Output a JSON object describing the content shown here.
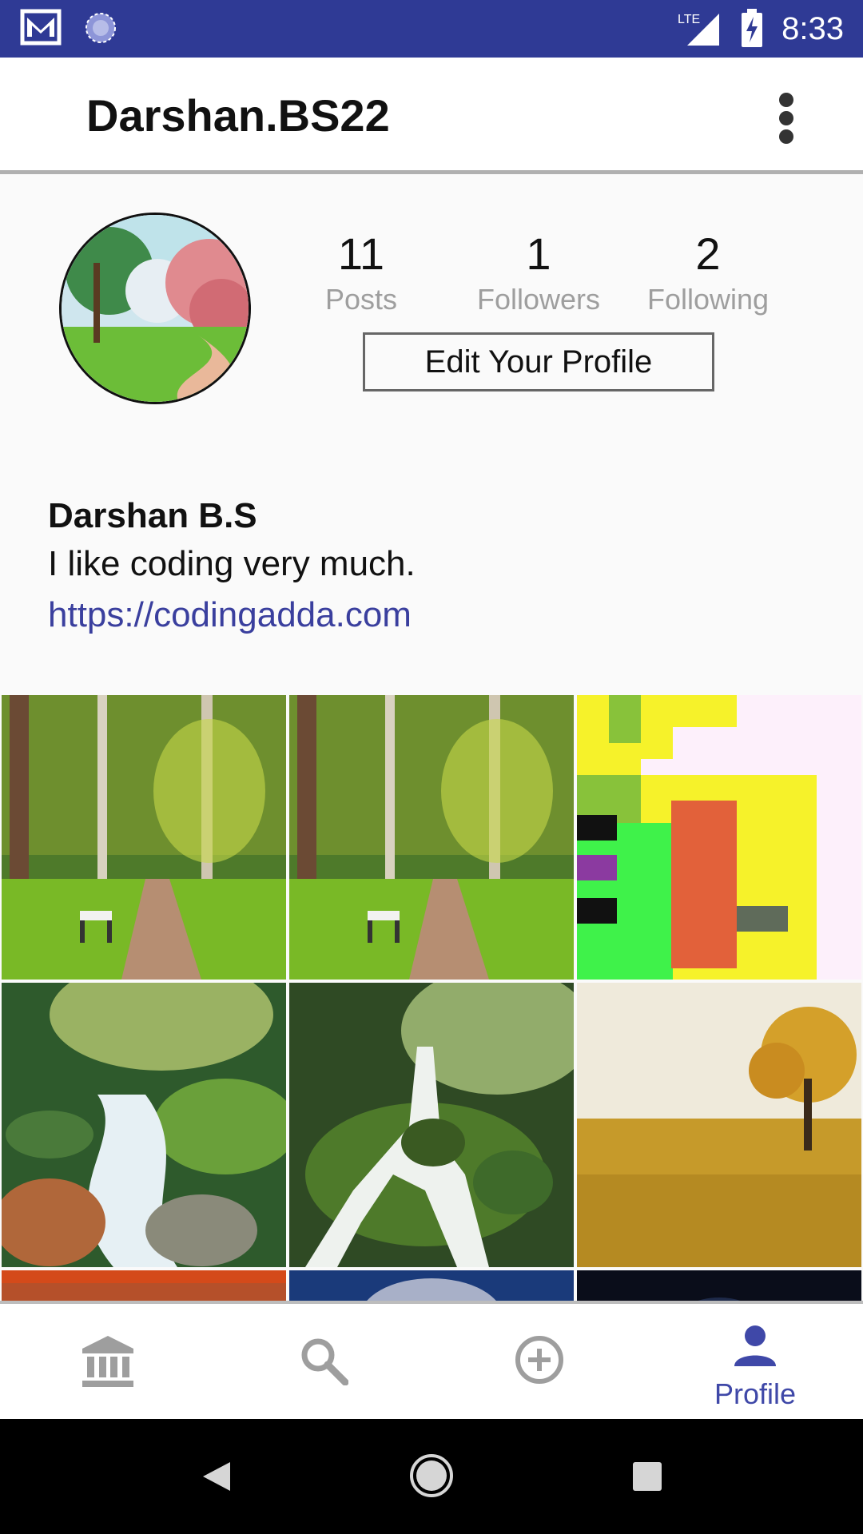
{
  "status_bar": {
    "time": "8:33",
    "network": "LTE",
    "icons": [
      "gmail-icon",
      "sync-icon",
      "lte-signal-icon",
      "battery-charging-icon"
    ]
  },
  "app_bar": {
    "title": "Darshan.BS22",
    "menu_icon": "more-vert-icon"
  },
  "profile": {
    "stats": [
      {
        "value": "11",
        "label": "Posts"
      },
      {
        "value": "1",
        "label": "Followers"
      },
      {
        "value": "2",
        "label": "Following"
      }
    ],
    "edit_button": "Edit Your Profile",
    "display_name": "Darshan B.S",
    "bio": "I like coding very much.",
    "website": "https://codingadda.com"
  },
  "grid": {
    "posts": [
      "forest-path-bench-image",
      "forest-path-bench-image",
      "pixel-art-image",
      "forest-stream-rocks-image",
      "waterfall-image",
      "golden-field-tree-image",
      "sunset-image",
      "planet-image",
      "night-sky-image"
    ]
  },
  "bottom_nav": {
    "items": [
      {
        "icon": "home-bank-icon",
        "label": ""
      },
      {
        "icon": "search-icon",
        "label": ""
      },
      {
        "icon": "add-circle-icon",
        "label": ""
      },
      {
        "icon": "person-icon",
        "label": "Profile"
      }
    ],
    "active_color": "#3f48a8",
    "inactive_color": "#9e9e9e"
  },
  "system_nav": {
    "icons": [
      "back-icon",
      "home-icon",
      "recents-icon"
    ]
  },
  "colors": {
    "status_bar": "#2f3a95",
    "link": "#3a3f9e"
  }
}
